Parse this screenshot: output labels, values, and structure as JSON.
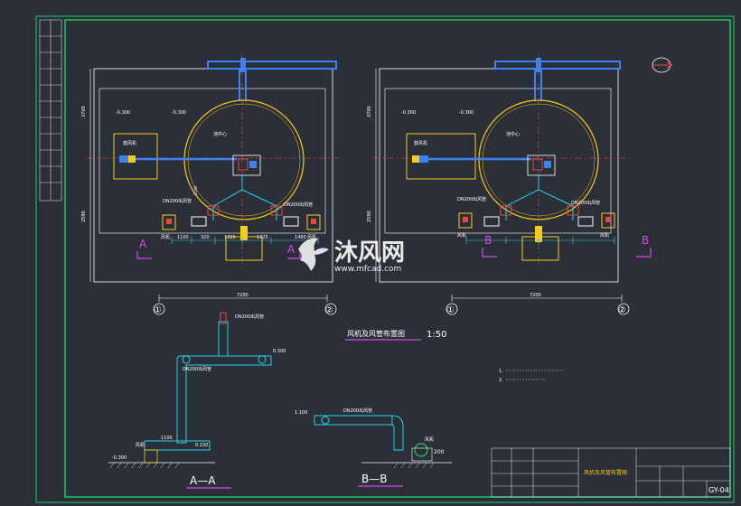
{
  "colors": {
    "background": "#2b2f38",
    "frame": "#22c55e",
    "plan_lines": "#ffffff",
    "tank": "#facc15",
    "dimension": "#22d3ee",
    "air_pipe": "#3b82f6",
    "valve": "#ef4444",
    "section_mark": "#d946ef",
    "watermark": "#ffffff"
  },
  "plan_left": {
    "level_a": "-0.300",
    "level_b": "-0.300",
    "tank_label": "池中心",
    "pipe_a": "DN200出风管",
    "pipe_b": "DN200出风管",
    "box_label": "鼓风机",
    "dim_v1": "3700",
    "dim_v2": "2590",
    "dim_v3": "2190",
    "dim_h1": "1100",
    "dim_h2": "320",
    "dim_h3": "1325",
    "dim_h4": "1325",
    "dim_h5": "1460",
    "dim_total": "7200",
    "eq_left": "风机",
    "eq_right": "风机",
    "axis_1": "①",
    "axis_2": "②",
    "section_left": "A",
    "section_right": "A"
  },
  "plan_right": {
    "level_a": "-0.300",
    "level_b": "-0.300",
    "tank_label": "池中心",
    "pipe_a": "DN200出风管",
    "pipe_b": "DN200出风管",
    "box_label": "鼓风机",
    "dim_v1": "3700",
    "dim_v2": "2590",
    "dim_total": "7200",
    "eq_left": "风机",
    "eq_right": "风机",
    "axis_1": "①",
    "axis_2": "②",
    "section_left": "B",
    "section_right": "B"
  },
  "plan_title": "风机及风管布置图",
  "plan_scale": "1:50",
  "notes": {
    "line1": "1.",
    "line2": "2."
  },
  "section_aa": {
    "pipe_label": "DN200出风管",
    "pipe_label_2": "DN200出风管",
    "level_top": "0.300",
    "level_bottom": "-0.300",
    "level_mid": "0.150",
    "dim": "1100",
    "eq": "风机",
    "title": "A—A"
  },
  "section_bb": {
    "pipe_label": "DN200出风管",
    "level": "1.100",
    "dim": "200",
    "eq": "风机",
    "title": "B—B"
  },
  "title_block": {
    "drawing_title": "风机及风管布置图",
    "drawing_no": "GY-04"
  },
  "watermark": {
    "brand": "沐风网",
    "url": "www.mfcad.com"
  }
}
